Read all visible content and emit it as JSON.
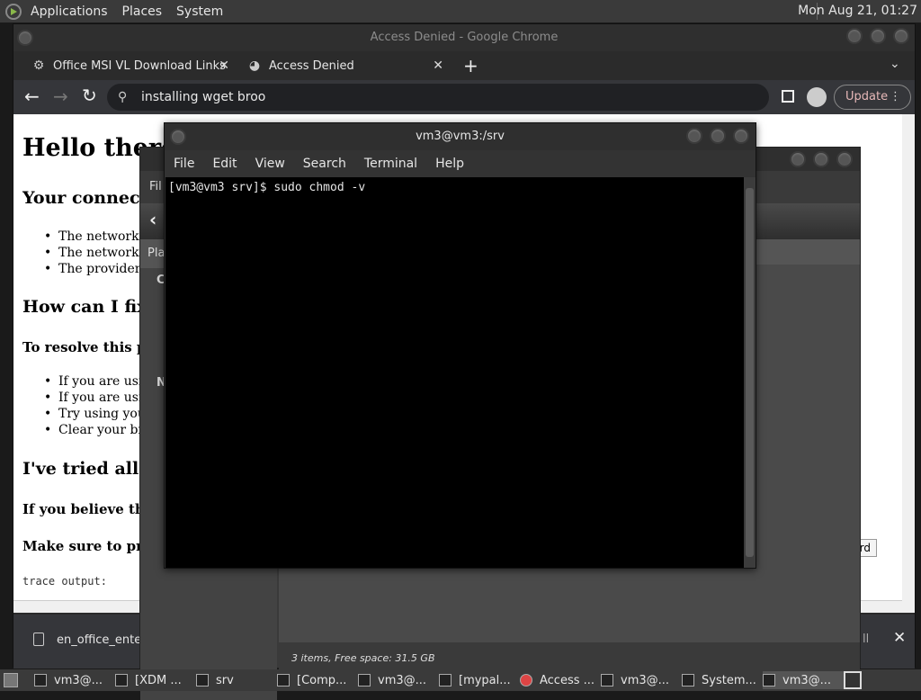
{
  "panel": {
    "menus": [
      "Applications",
      "Places",
      "System"
    ],
    "clock": "Mon Aug 21, 01:27"
  },
  "chrome": {
    "title": "Access Denied - Google Chrome",
    "tabs": [
      {
        "label": "Office MSI VL Download Links",
        "icon": "gear-icon"
      },
      {
        "label": "Access Denied",
        "icon": "incognito-icon"
      }
    ],
    "omnibox": "installing wget broo",
    "update_label": "Update",
    "page": {
      "h1": "Hello there!",
      "connect_heading": "Your connect",
      "reasons": [
        "The network y",
        "The network y",
        "The provider c"
      ],
      "fix_heading": "How can I fix",
      "resolve_heading": "To resolve this pr",
      "fixes": [
        "If you are usin",
        "If you are usin",
        "Try using your",
        "Clear your bro"
      ],
      "tried_heading": "I've tried all",
      "believe_text": "If you believe tha",
      "sure_text": "Make sure to pro",
      "trace": "trace output:",
      "button_partial": "rd"
    },
    "download": {
      "filename": "en_office_ente",
      "partial_action": "ll"
    }
  },
  "filemanager": {
    "menu_partial": "Fil",
    "places_partial": "Pla",
    "side_c": "C",
    "side_n": "N",
    "status": "3 items, Free space: 31.5 GB"
  },
  "terminal": {
    "title": "vm3@vm3:/srv",
    "menus": [
      "File",
      "Edit",
      "View",
      "Search",
      "Terminal",
      "Help"
    ],
    "prompt": "[vm3@vm3 srv]$ sudo chmod -v"
  },
  "taskbar": [
    {
      "label": "vm3@...",
      "icon": "terminal-icon"
    },
    {
      "label": "[XDM ...",
      "icon": "xdm-icon"
    },
    {
      "label": "srv",
      "icon": "folder-icon"
    },
    {
      "label": "[Comp...",
      "icon": "folder-icon"
    },
    {
      "label": "vm3@...",
      "icon": "terminal-icon"
    },
    {
      "label": "[mypal...",
      "icon": "mypal-icon"
    },
    {
      "label": "Access ...",
      "icon": "chrome-icon"
    },
    {
      "label": "vm3@...",
      "icon": "terminal-icon"
    },
    {
      "label": "System...",
      "icon": "monitor-icon"
    },
    {
      "label": "vm3@...",
      "icon": "terminal-icon"
    }
  ]
}
